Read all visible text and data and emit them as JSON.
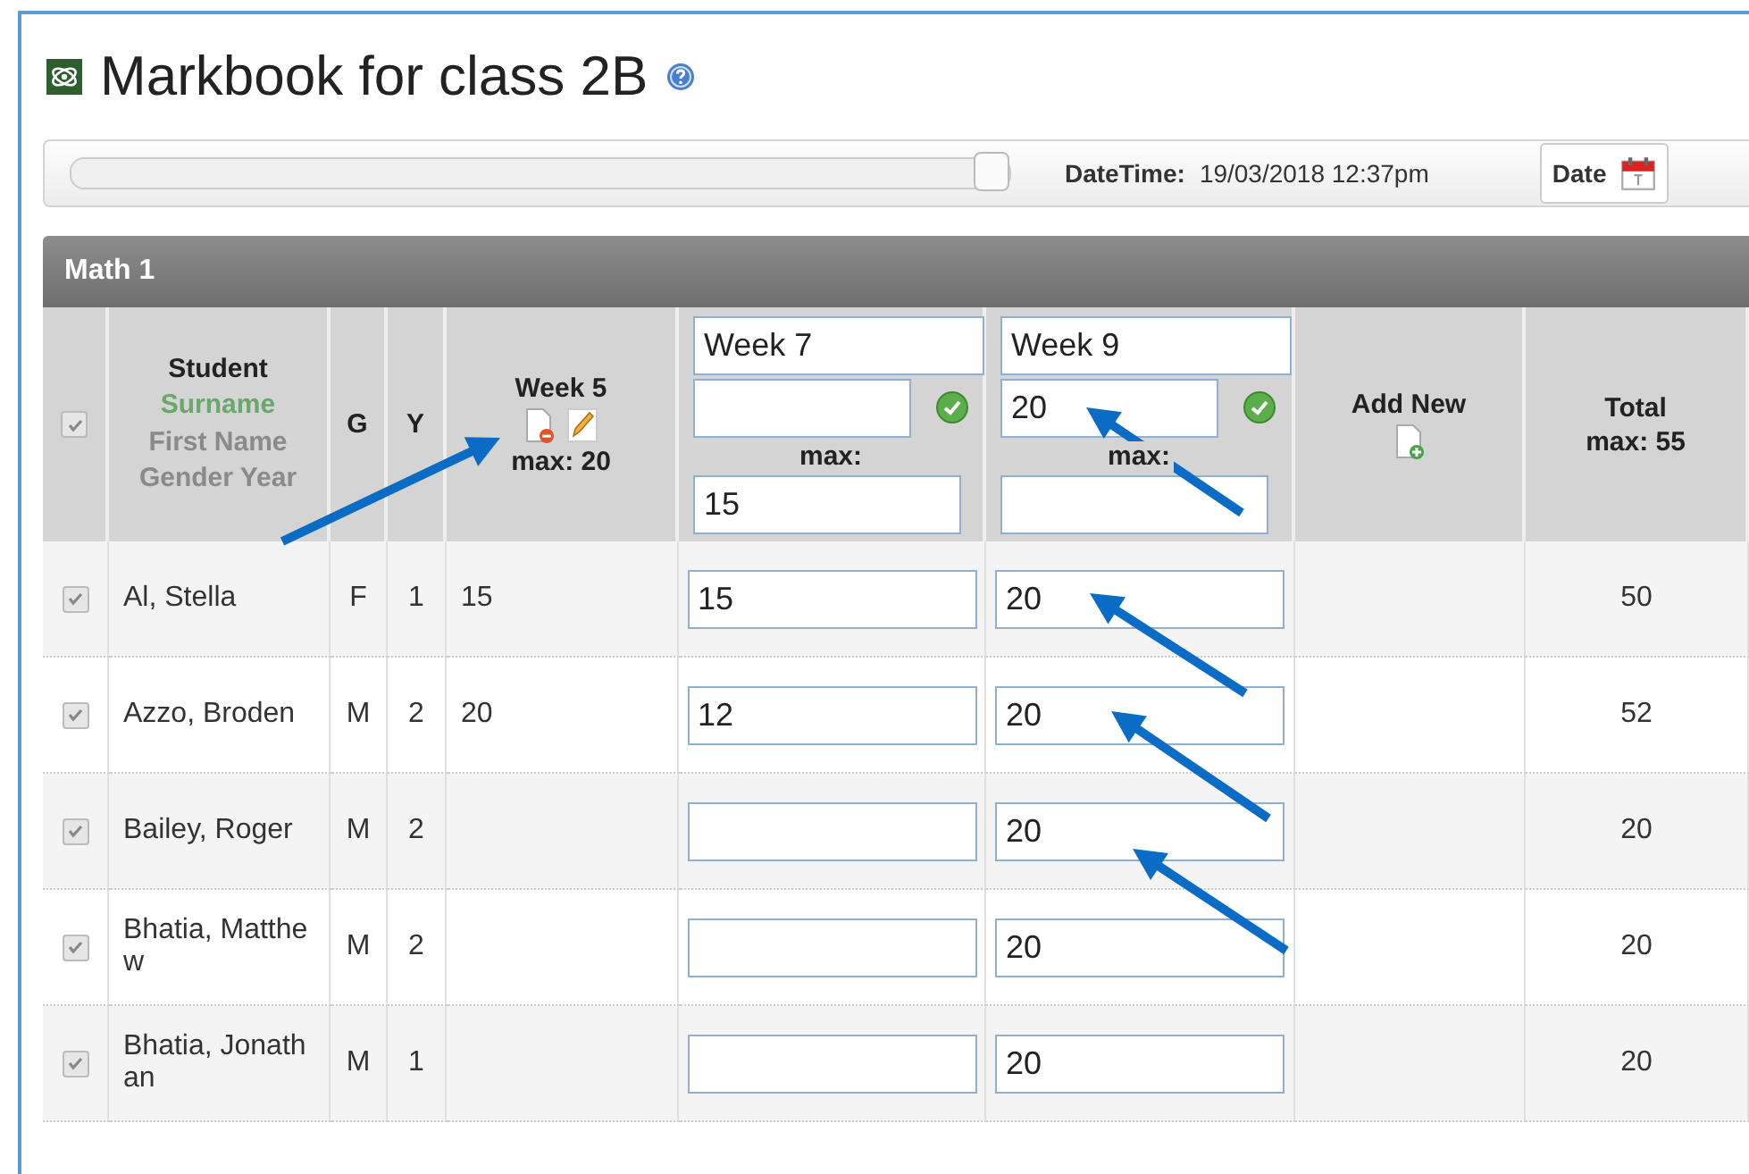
{
  "page": {
    "title": "Markbook for class 2B"
  },
  "toolbar": {
    "slider": {
      "level": 1
    },
    "datetime_label": "DateTime:",
    "datetime_value": "19/03/2018 12:37pm",
    "date_button": "Date"
  },
  "section": {
    "title": "Math 1"
  },
  "header": {
    "select_all": {
      "checked": true,
      "disabled": true
    },
    "student": "Student",
    "surname": "Surname",
    "first_name": "First Name",
    "gender_year": "Gender Year",
    "gender": "G",
    "year": "Y",
    "week5": {
      "title": "Week 5",
      "max": "max: 20"
    },
    "edit_columns": [
      {
        "title": "Week 7",
        "max_label": "max:",
        "max": "15"
      },
      {
        "title": "Week 9",
        "score": "20",
        "max_label": "max:"
      }
    ],
    "add_new": "Add New",
    "total": "Total",
    "total_max": "max: 55"
  },
  "rows": [
    {
      "checked": true,
      "name": "Al, Stella",
      "gender": "F",
      "year": "1",
      "week5": "15",
      "week7": "15",
      "week9": "20",
      "total": "50"
    },
    {
      "checked": true,
      "name": "Azzo, Broden",
      "gender": "M",
      "year": "2",
      "week5": "20",
      "week7": "12",
      "week9": "20",
      "total": "52"
    },
    {
      "checked": true,
      "name": "Bailey, Roger",
      "gender": "M",
      "year": "2",
      "week9": "20",
      "total": "20"
    },
    {
      "checked": true,
      "name": "Bhatia, Matthew",
      "gender": "M",
      "year": "2",
      "week9": "20",
      "total": "20"
    },
    {
      "checked": true,
      "name": "Bhatia, Jonathan",
      "gender": "M",
      "year": "1",
      "week9": "20",
      "total": "20"
    }
  ]
}
